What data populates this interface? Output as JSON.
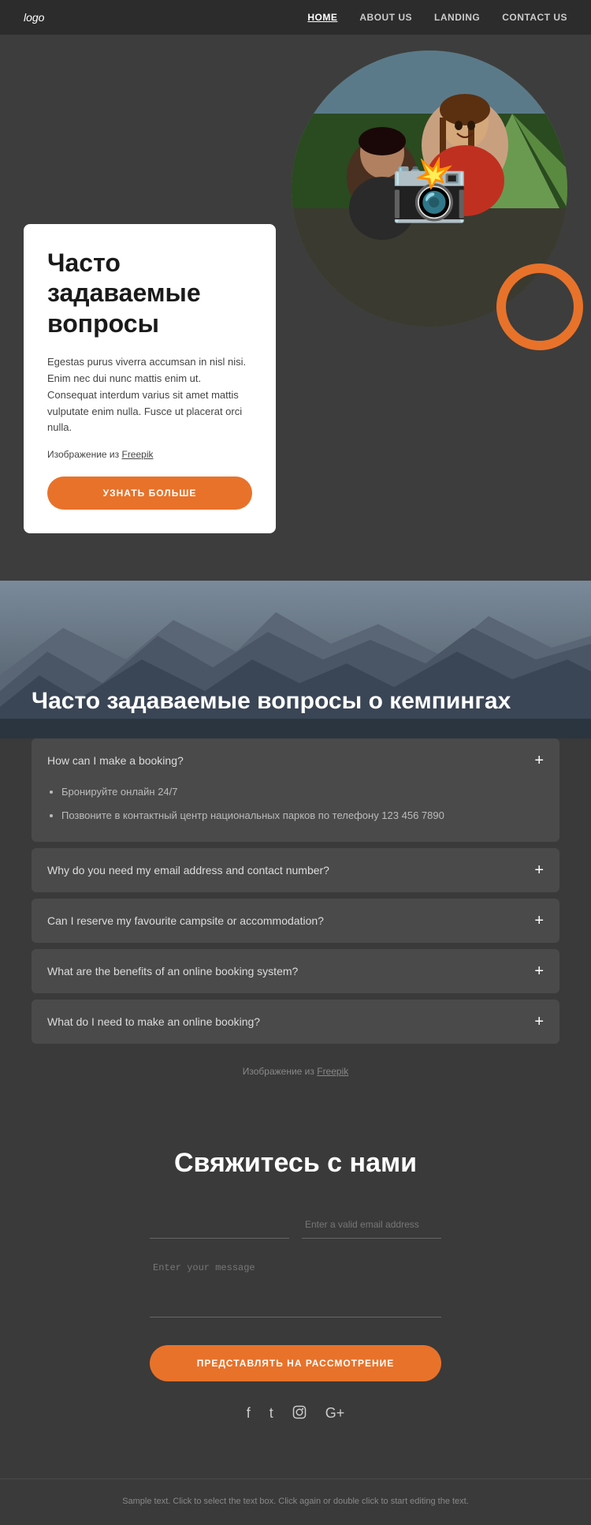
{
  "nav": {
    "logo": "logo",
    "links": [
      {
        "label": "HOME",
        "href": "#",
        "active": true
      },
      {
        "label": "ABOUT US",
        "href": "#",
        "active": false
      },
      {
        "label": "LANDING",
        "href": "#",
        "active": false
      },
      {
        "label": "CONTACT US",
        "href": "#",
        "active": false
      }
    ]
  },
  "hero": {
    "title": "Часто задаваемые вопросы",
    "description": "Egestas purus viverra accumsan in nisl nisi. Enim nec dui nunc mattis enim ut. Consequat interdum varius sit amet mattis vulputate enim nulla. Fusce ut placerat orci nulla.",
    "image_attr": "Изображение из",
    "freepik_label": "Freepik",
    "cta_label": "УЗНАТЬ БОЛЬШЕ"
  },
  "mountains": {
    "title": "Часто задаваемые вопросы о кемпингах"
  },
  "faq": {
    "items": [
      {
        "question": "How can I make a booking?",
        "open": true,
        "answer_items": [
          "Бронируйте онлайн 24/7",
          "Позвоните в контактный центр национальных парков по телефону 123 456 7890"
        ]
      },
      {
        "question": "Why do you need my email address and contact number?",
        "open": false,
        "answer_items": []
      },
      {
        "question": "Can I reserve my favourite campsite or accommodation?",
        "open": false,
        "answer_items": []
      },
      {
        "question": "What are the benefits of an online booking system?",
        "open": false,
        "answer_items": []
      },
      {
        "question": "What do I need to make an online booking?",
        "open": false,
        "answer_items": []
      }
    ],
    "freepik_attr": "Изображение из",
    "freepik_label": "Freepik"
  },
  "contact": {
    "title": "Свяжитесь с нами",
    "name_placeholder": "",
    "email_placeholder": "Enter a valid email address",
    "message_placeholder": "Enter your message",
    "submit_label": "ПРЕДСТАВЛЯТЬ НА РАССМОТРЕНИЕ"
  },
  "social": {
    "icons": [
      "f",
      "t",
      "ig",
      "g+"
    ]
  },
  "footer": {
    "text": "Sample text. Click to select the text box. Click again or double click to start editing the text."
  }
}
